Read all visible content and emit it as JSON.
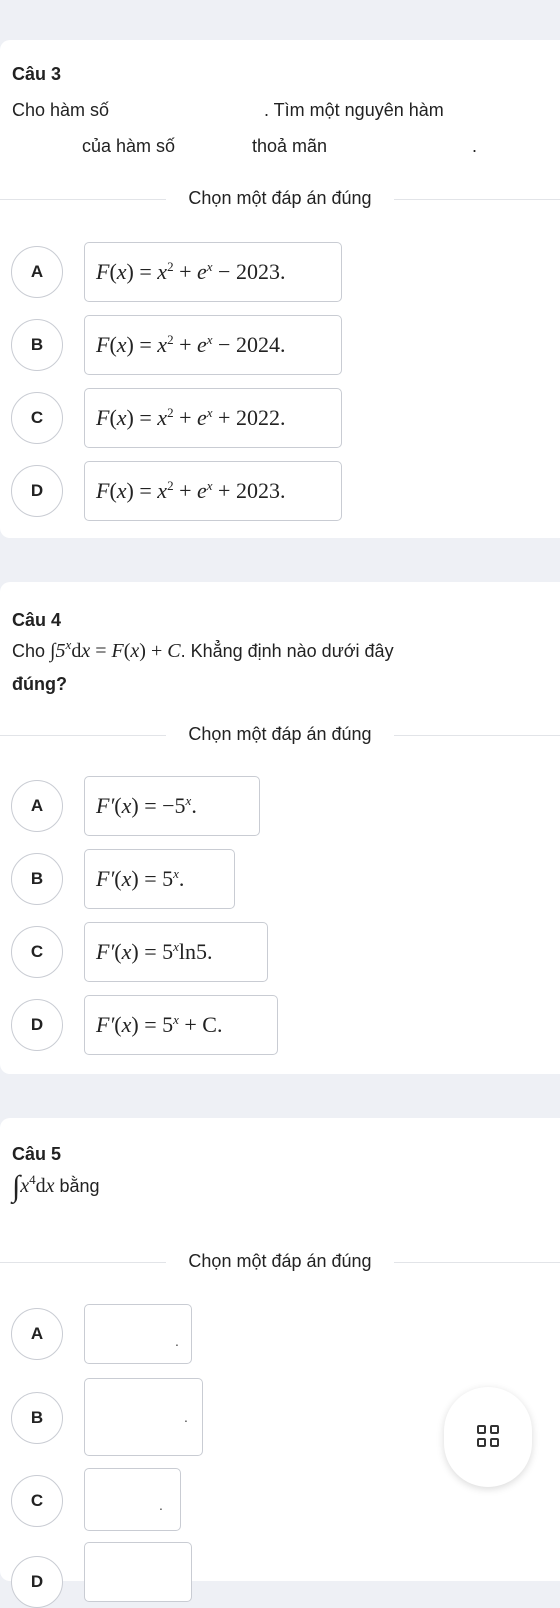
{
  "common": {
    "choose_label": "Chọn một đáp án đúng"
  },
  "q3": {
    "title": "Câu 3",
    "line1_a": "Cho hàm số",
    "line1_b": ". Tìm một nguyên hàm",
    "line2_a": "của hàm số",
    "line2_b": "thoả mãn",
    "line2_c": ".",
    "options": [
      {
        "letter": "A",
        "lhs": "F",
        "rhs_const": "− 2023."
      },
      {
        "letter": "B",
        "lhs": "F",
        "rhs_const": "− 2024."
      },
      {
        "letter": "C",
        "lhs": "F",
        "rhs_const": "+ 2022."
      },
      {
        "letter": "D",
        "lhs": "F",
        "rhs_const": "+ 2023."
      }
    ]
  },
  "q4": {
    "title": "Câu 4",
    "text_prefix": "Cho",
    "text_suffix": ". Khẳng định nào dưới đây",
    "text_line2": "đúng?",
    "options": [
      {
        "letter": "A",
        "rhs": "−5",
        "tail": "."
      },
      {
        "letter": "B",
        "rhs": "5",
        "tail": "."
      },
      {
        "letter": "C",
        "rhs": "5",
        "tail": "ln5."
      },
      {
        "letter": "D",
        "rhs": "5",
        "tail": "+ C."
      }
    ]
  },
  "q5": {
    "title": "Câu 5",
    "text_suffix": "bằng",
    "options": [
      {
        "letter": "A",
        "content": "."
      },
      {
        "letter": "B",
        "content": "."
      },
      {
        "letter": "C",
        "content": "."
      },
      {
        "letter": "D",
        "content": ""
      }
    ]
  },
  "fab": {
    "icon": "grid-icon"
  }
}
